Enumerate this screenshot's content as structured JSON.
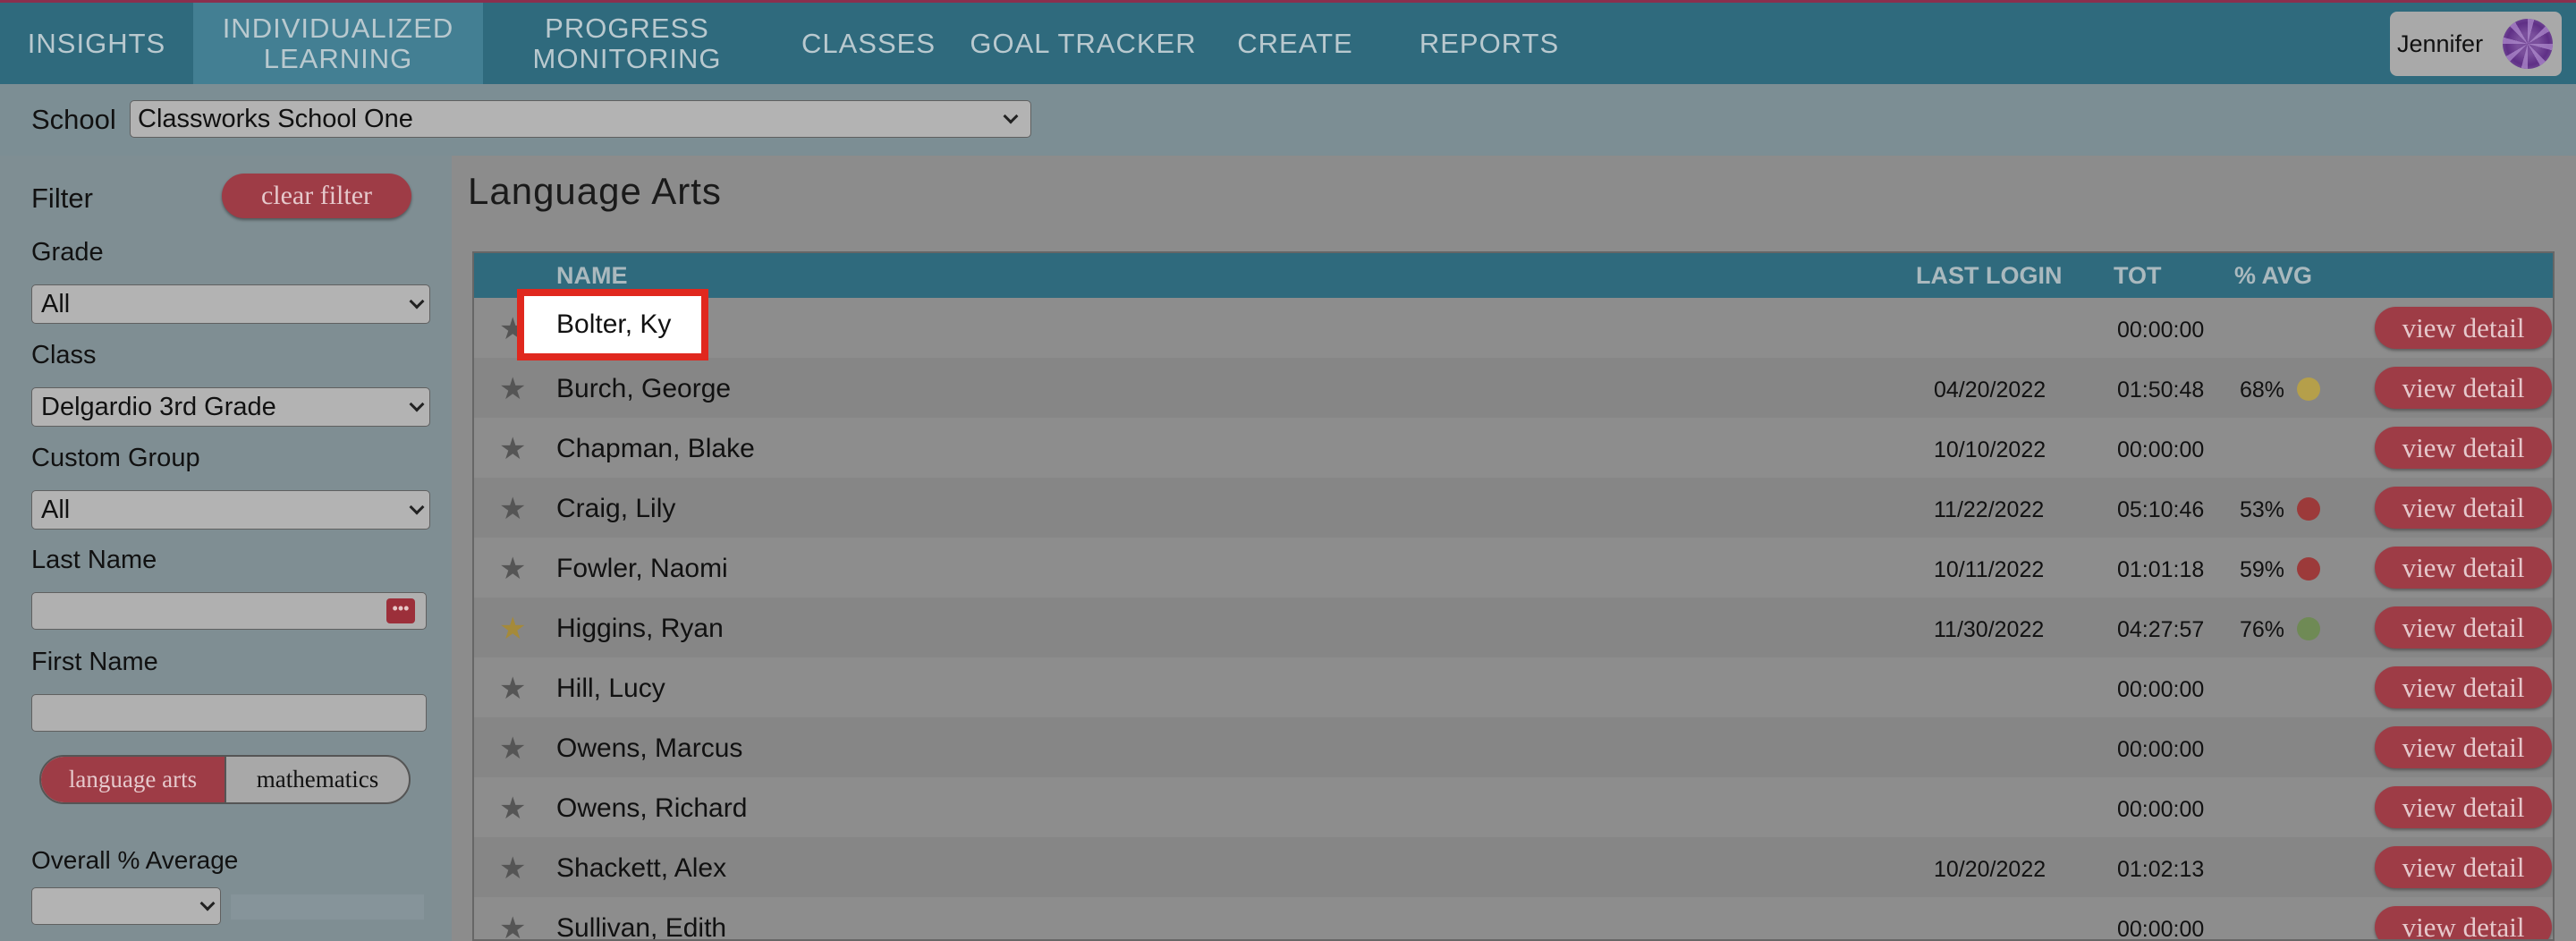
{
  "nav": {
    "items": [
      {
        "label": "INSIGHTS"
      },
      {
        "label_line1": "INDIVIDUALIZED",
        "label_line2": "LEARNING"
      },
      {
        "label_line1": "PROGRESS",
        "label_line2": "MONITORING"
      },
      {
        "label": "CLASSES"
      },
      {
        "label": "GOAL TRACKER"
      },
      {
        "label": "CREATE"
      },
      {
        "label": "REPORTS"
      }
    ],
    "user_name": "Jennifer"
  },
  "school": {
    "label": "School",
    "selected": "Classworks School One"
  },
  "sidebar": {
    "filter_title": "Filter",
    "clear_filter": "clear filter",
    "grade_label": "Grade",
    "grade_value": "All",
    "class_label": "Class",
    "class_value": "Delgardio 3rd Grade",
    "custom_group_label": "Custom Group",
    "custom_group_value": "All",
    "last_name_label": "Last Name",
    "first_name_label": "First Name",
    "subject_language_arts": "language arts",
    "subject_mathematics": "mathematics",
    "overall_avg_label": "Overall % Average"
  },
  "main": {
    "title": "Language Arts",
    "columns": {
      "name": "NAME",
      "last_login": "LAST LOGIN",
      "tot": "TOT",
      "avg": "% AVG"
    },
    "view_detail_label": "view detail",
    "rows": [
      {
        "name": "Bolter, Ky",
        "last_login": "",
        "tot": "00:00:00",
        "avg": "",
        "status": ""
      },
      {
        "name": "Burch, George",
        "last_login": "04/20/2022",
        "tot": "01:50:48",
        "avg": "68%",
        "status": "yellow"
      },
      {
        "name": "Chapman, Blake",
        "last_login": "10/10/2022",
        "tot": "00:00:00",
        "avg": "",
        "status": ""
      },
      {
        "name": "Craig, Lily",
        "last_login": "11/22/2022",
        "tot": "05:10:46",
        "avg": "53%",
        "status": "red"
      },
      {
        "name": "Fowler, Naomi",
        "last_login": "10/11/2022",
        "tot": "01:01:18",
        "avg": "59%",
        "status": "red"
      },
      {
        "name": "Higgins, Ryan",
        "last_login": "11/30/2022",
        "tot": "04:27:57",
        "avg": "76%",
        "status": "green",
        "favorite": true
      },
      {
        "name": "Hill, Lucy",
        "last_login": "",
        "tot": "00:00:00",
        "avg": "",
        "status": ""
      },
      {
        "name": "Owens, Marcus",
        "last_login": "",
        "tot": "00:00:00",
        "avg": "",
        "status": ""
      },
      {
        "name": "Owens, Richard",
        "last_login": "",
        "tot": "00:00:00",
        "avg": "",
        "status": ""
      },
      {
        "name": "Shackett, Alex",
        "last_login": "10/20/2022",
        "tot": "01:02:13",
        "avg": "",
        "status": ""
      },
      {
        "name": "Sullivan, Edith",
        "last_login": "",
        "tot": "00:00:00",
        "avg": "",
        "status": ""
      }
    ],
    "highlighted_name": "Bolter, Ky"
  },
  "colors": {
    "nav_bg": "#2f6a7d",
    "button_red": "#9e3c46",
    "status_yellow": "#b59f4a",
    "status_red": "#9c3a3a",
    "status_green": "#6f8a55",
    "highlight_border": "#e0281e"
  },
  "icons": {
    "star": "star-icon",
    "dots": "ellipsis-icon",
    "chevron": "chevron-down-icon",
    "avatar": "avatar"
  }
}
